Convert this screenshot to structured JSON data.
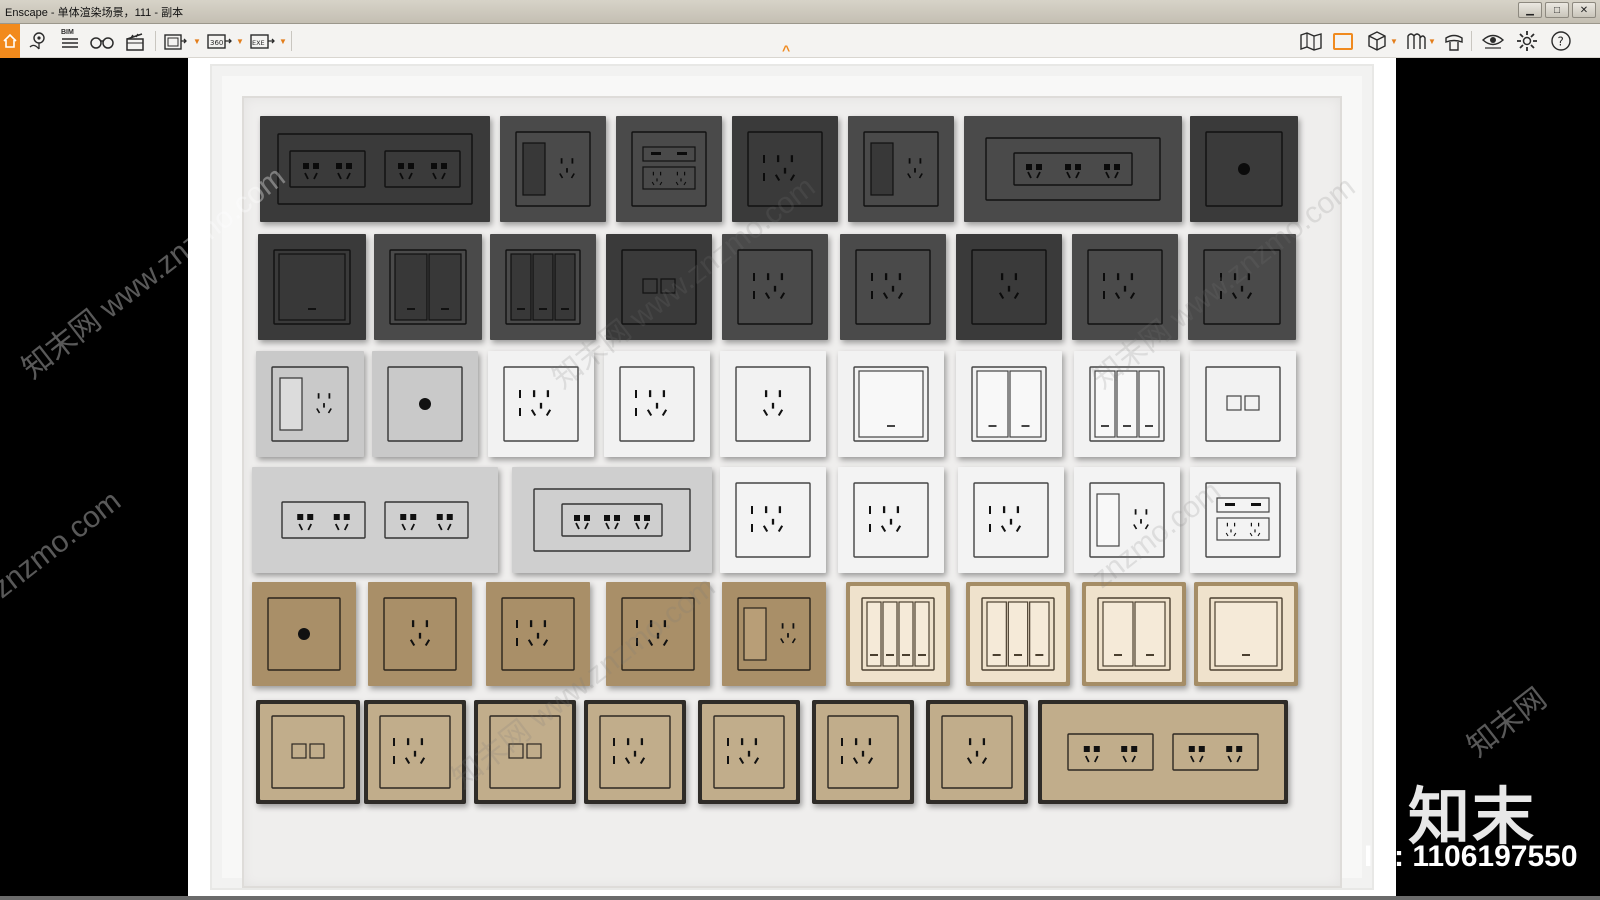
{
  "window": {
    "title": "Enscape - 单体渲染场景，111 - 副本",
    "minimize_label": "▁",
    "maximize_label": "□",
    "close_label": "✕"
  },
  "toolbar": {
    "left_tools": [
      "home-icon",
      "location-pin-icon",
      "bim-icon",
      "binoculars-icon",
      "clapperboard-icon",
      "screenshot-export-icon",
      "panorama-360-icon",
      "exe-export-icon"
    ],
    "bim_label": "BIM",
    "panorama_label": "360",
    "exe_label": "EXE",
    "right_tools": [
      "map-icon",
      "chart-panel-icon",
      "cube-icon",
      "materials-icon",
      "asset-library-icon",
      "visibility-icon",
      "settings-icon",
      "help-icon"
    ],
    "help_label": "?",
    "collapse_label": "^"
  },
  "viewport": {
    "brand_logo": "知末",
    "brand_id": "ID: 1106197550",
    "watermarks": [
      "知末网 www.znzmo.com",
      "znzmo.com",
      "知末网 www.znzmo.com",
      "知末网 www.znzmo.com",
      "znzmo.com",
      "知末网",
      "知末网 www.znzmo.com"
    ]
  },
  "colors": {
    "accent_orange": "#f08a1f",
    "panel_dark": "#3d3d3d",
    "panel_gray": "#d6d6d6",
    "panel_white": "#f4f4f4",
    "panel_bronze": "#b59b72",
    "panel_champagne": "#e7d8bf"
  },
  "panel_rows": [
    {
      "finish": "dark",
      "types": [
        "double-socket-long",
        "switch-socket",
        "usb-socket",
        "five-pin-socket",
        "switch-socket",
        "triple-socket-long",
        "tv-outlet"
      ]
    },
    {
      "finish": "dark",
      "types": [
        "one-gang-switch",
        "two-gang-switch",
        "three-gang-switch",
        "network-outlet",
        "five-pin-socket",
        "five-pin-socket",
        "three-pin-socket",
        "five-pin-socket",
        "five-pin-socket"
      ]
    },
    {
      "finish": "gray-white",
      "types": [
        "switch-socket",
        "tv-outlet",
        "five-pin-socket",
        "five-pin-socket",
        "three-pin-socket",
        "one-gang-switch",
        "two-gang-switch",
        "three-gang-switch",
        "network-outlet"
      ]
    },
    {
      "finish": "gray-white",
      "types": [
        "double-socket-long",
        "triple-socket-long",
        "five-pin-socket",
        "five-pin-socket",
        "five-pin-socket",
        "switch-socket",
        "usb-socket"
      ]
    },
    {
      "finish": "bronze-champagne",
      "types": [
        "tv-outlet",
        "three-pin-socket",
        "five-pin-socket",
        "five-pin-socket",
        "switch-socket",
        "four-gang-switch",
        "three-gang-switch",
        "two-gang-switch",
        "one-gang-switch"
      ]
    },
    {
      "finish": "gold-framed",
      "types": [
        "network-outlet",
        "five-pin-socket",
        "network-outlet",
        "five-pin-socket",
        "five-pin-socket",
        "five-pin-socket",
        "two-pin-socket",
        "double-socket-long"
      ]
    }
  ]
}
